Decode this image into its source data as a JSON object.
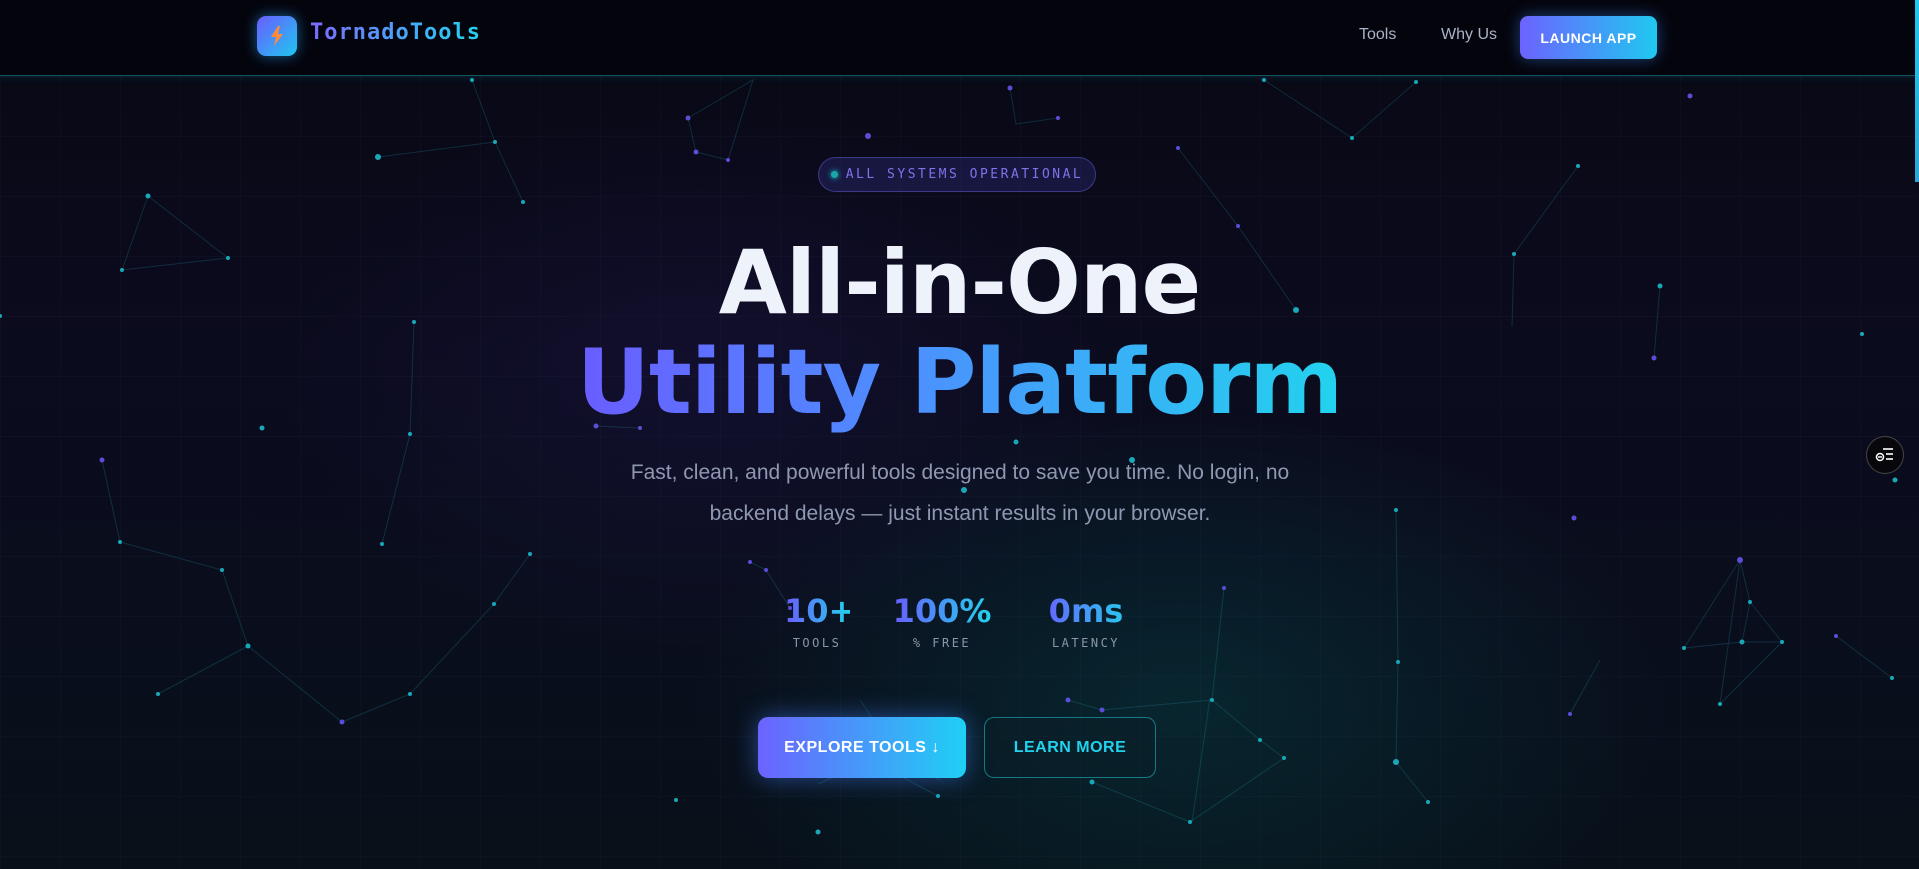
{
  "nav": {
    "logo_icon": "bolt-icon",
    "brand": "TornadoTools",
    "links": [
      "Tools",
      "Why Us"
    ],
    "cta": "LAUNCH APP"
  },
  "hero": {
    "status_badge": "ALL SYSTEMS OPERATIONAL",
    "title_line1": "All-in-One",
    "title_line2": "Utility Platform",
    "subtitle_line1": "Fast, clean, and powerful tools designed to save you time. No login, no",
    "subtitle_line2": "backend delays — just instant results in your browser.",
    "stats": [
      {
        "value": "10+",
        "label": "TOOLS"
      },
      {
        "value": "100%",
        "label": "% FREE"
      },
      {
        "value": "0ms",
        "label": "LATENCY"
      }
    ],
    "primary_button": "EXPLORE TOOLS ↓",
    "secondary_button": "LEARN MORE"
  },
  "side_widget_icon": "accessibility-menu-icon",
  "colors": {
    "background": "#06060f",
    "accent_purple": "#6a5cff",
    "accent_cyan": "#22d3ee",
    "text_muted": "#8f98b2"
  }
}
